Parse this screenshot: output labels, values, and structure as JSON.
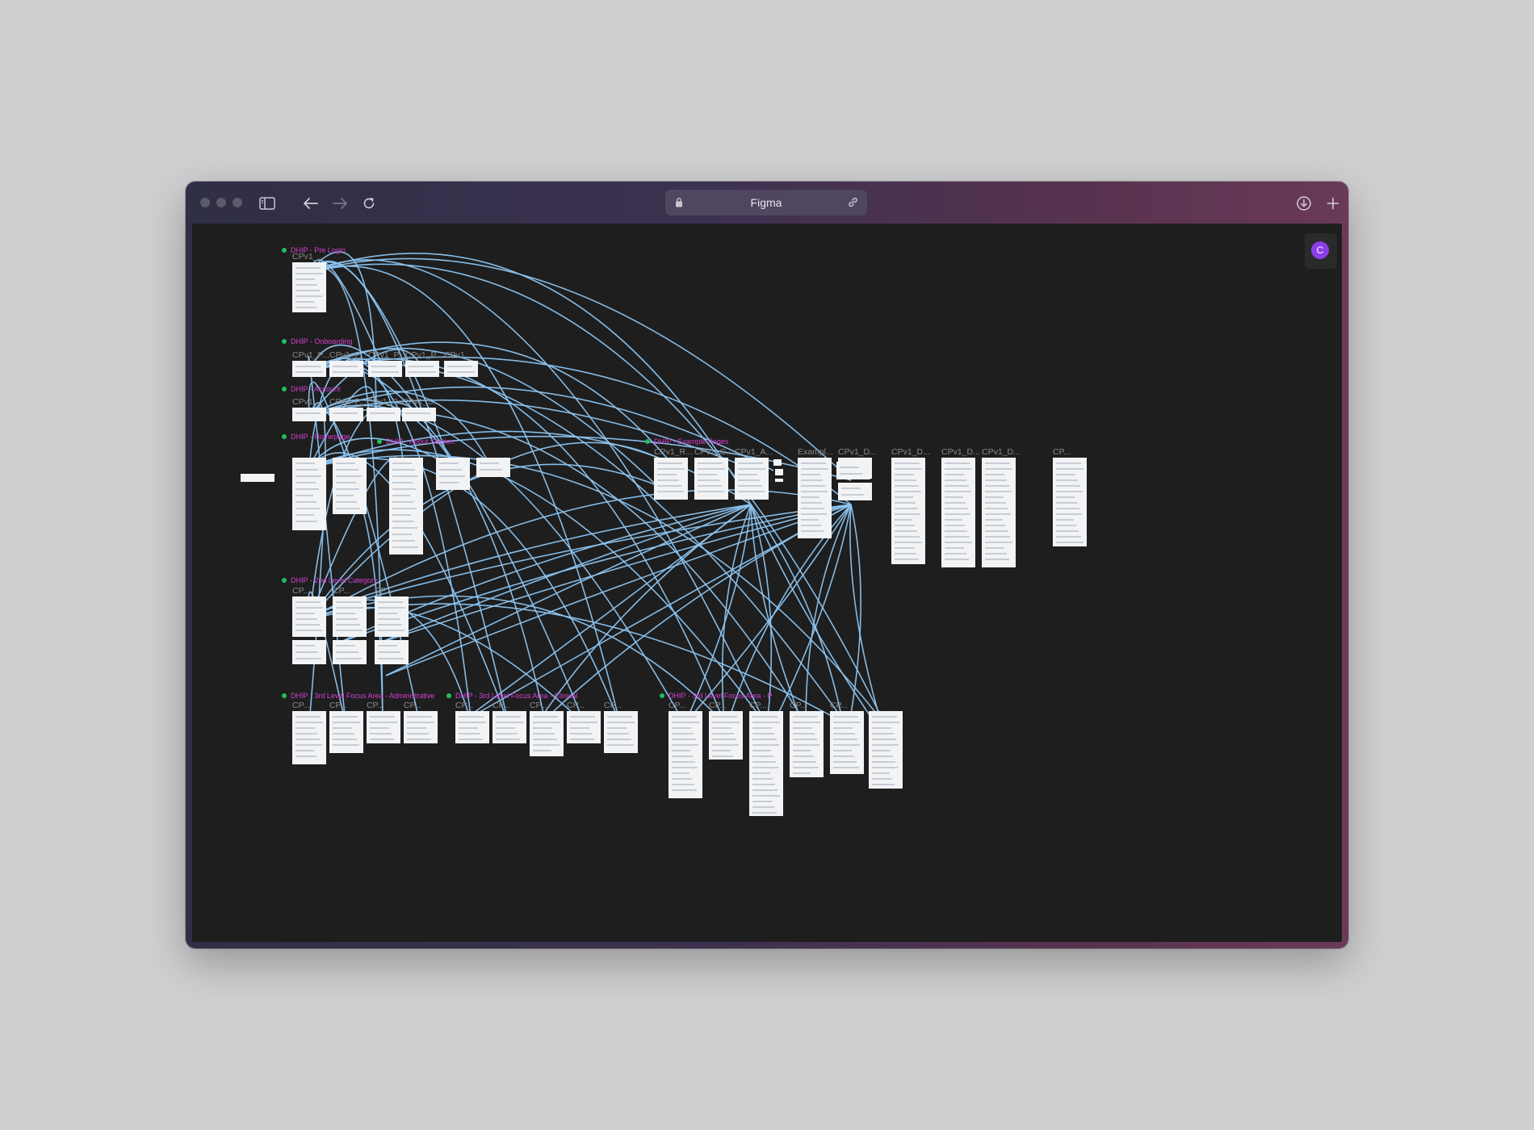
{
  "browser": {
    "url_title": "Figma",
    "icons": {
      "sidebar": "sidebar-icon",
      "back": "arrow-left-icon",
      "forward": "arrow-right-icon",
      "reload": "reload-icon",
      "lock": "lock-icon",
      "link": "link-icon",
      "download": "download-icon",
      "new_tab": "plus-icon"
    }
  },
  "figma": {
    "avatar_initial": "C",
    "avatar_color": "#8a3ee8",
    "flow_color": "#8cc4f0",
    "section_label_color": "#d63fd3",
    "sections": [
      {
        "label": "DHIP - Pre Login"
      },
      {
        "label": "DHIP - Onboarding"
      },
      {
        "label": "DHIP - Account"
      },
      {
        "label": "DHIP - Homepage"
      },
      {
        "label": "DHIP - About Section"
      },
      {
        "label": "DHIP - Example Pages"
      },
      {
        "label": "DHIP - 2nd Level Category"
      },
      {
        "label": "DHIP - 3rd Level Focus Area - Administrative"
      },
      {
        "label": "DHIP - 3rd Level Focus Area - Clinical"
      },
      {
        "label": "DHIP - 3rd Level Focus Area - P"
      }
    ],
    "frames": [
      {
        "label": "CPv1_..."
      },
      {
        "label": "CPv1_P..."
      },
      {
        "label": "CPv1_P..."
      },
      {
        "label": "CPv1_P..."
      },
      {
        "label": "CPv1_P..."
      },
      {
        "label": "CPv1_..."
      },
      {
        "label": "CPv1_..."
      },
      {
        "label": "CPv1_P..."
      },
      {
        "label": "CPv1_P..."
      },
      {
        "label": "CPv1_S..."
      },
      {
        "label": "CPv1_R..."
      },
      {
        "label": "CPv1_C..."
      },
      {
        "label": "CPv1_A..."
      },
      {
        "label": "Exampl..."
      },
      {
        "label": "CPv1_D..."
      },
      {
        "label": "CPv1_D..."
      },
      {
        "label": "CPv1_D..."
      },
      {
        "label": "CPv1_D..."
      },
      {
        "label": "CP..."
      },
      {
        "label": "CP..."
      },
      {
        "label": "CP..."
      },
      {
        "label": "CP..."
      },
      {
        "label": "CP..."
      },
      {
        "label": "CP..."
      },
      {
        "label": "CP..."
      },
      {
        "label": "CP..."
      },
      {
        "label": "CP..."
      },
      {
        "label": "CP..."
      },
      {
        "label": "CP..."
      },
      {
        "label": "CP..."
      },
      {
        "label": "CP..."
      },
      {
        "label": "CP..."
      },
      {
        "label": "CP..."
      },
      {
        "label": "CP..."
      },
      {
        "label": "CP..."
      },
      {
        "label": "CP..."
      }
    ]
  }
}
